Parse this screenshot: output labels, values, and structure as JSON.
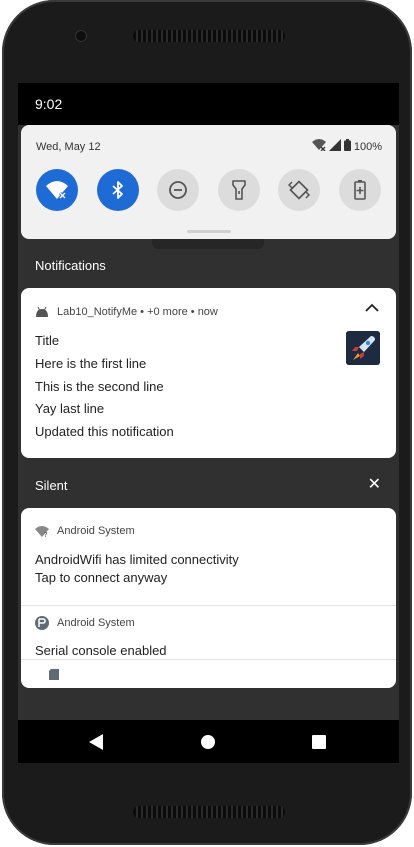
{
  "status_bar": {
    "time": "9:02"
  },
  "quick_settings": {
    "date": "Wed, May 12",
    "battery": "100%",
    "tiles": [
      {
        "name": "wifi",
        "active": true
      },
      {
        "name": "bluetooth",
        "active": true
      },
      {
        "name": "do-not-disturb",
        "active": false
      },
      {
        "name": "flashlight",
        "active": false
      },
      {
        "name": "auto-rotate",
        "active": false
      },
      {
        "name": "battery-saver",
        "active": false
      }
    ]
  },
  "notifications_section": {
    "title": "Notifications",
    "app_header": "Lab10_NotifyMe • +0 more • now",
    "lines": [
      "Title",
      "Here is the first line",
      "This is the second line",
      "Yay last line",
      "Updated this notification"
    ]
  },
  "silent_section": {
    "title": "Silent",
    "items": [
      {
        "app": "Android System",
        "text1": "AndroidWifi has limited connectivity",
        "text2": "Tap to connect anyway"
      },
      {
        "app": "Android System",
        "text1": "Serial console enabled"
      }
    ]
  },
  "colors": {
    "accent": "#1e6bd6",
    "shade": "#303030",
    "card": "#ffffff"
  }
}
